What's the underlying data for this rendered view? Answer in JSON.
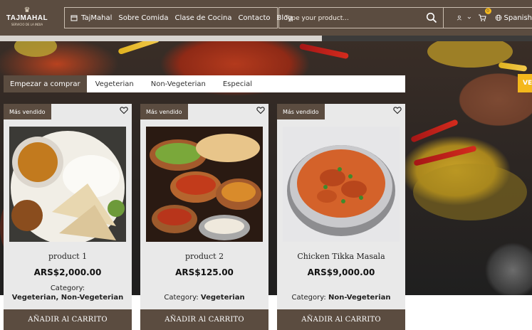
{
  "brand": {
    "name": "TAJMAHAL",
    "tagline": "SERVICIO DE LA INDIA"
  },
  "nav": {
    "items": [
      {
        "label": "TajMahal",
        "icon": "store-icon"
      },
      {
        "label": "Sobre Comida"
      },
      {
        "label": "Clase de Cocina"
      },
      {
        "label": "Contacto"
      },
      {
        "label": "Blog"
      }
    ]
  },
  "search": {
    "placeholder": "Type your product...",
    "value": "",
    "icon": "search-icon"
  },
  "account": {
    "user_icon": "user-icon",
    "cart_icon": "cart-icon",
    "cart_count": "0",
    "language": "Spanish"
  },
  "tabs": [
    "Empezar a comprar",
    "Vegeterian",
    "Non-Vegeterian",
    "Especial"
  ],
  "promo_badge": "VE",
  "colors": {
    "brand": "#5b4c40",
    "accent": "#f4b81c",
    "card_bg": "#e9e9e9"
  },
  "products": [
    {
      "badge": "Más vendido",
      "name": "product 1",
      "price": "ARS$2,000.00",
      "category_label": "Category:",
      "category_value": "Vegeterian, Non-Vegeterian",
      "button": "AÑADIR Al CARRITO"
    },
    {
      "badge": "Más vendido",
      "name": "product 2",
      "price": "ARS$125.00",
      "category_label": "Category:",
      "category_value": "Vegeterian",
      "button": "AÑADIR Al CARRITO"
    },
    {
      "badge": "Más vendido",
      "name": "Chicken Tikka Masala",
      "price": "ARS$9,000.00",
      "category_label": "Category:",
      "category_value": "Non-Vegeterian",
      "button": "AÑADIR Al CARRITO"
    }
  ]
}
